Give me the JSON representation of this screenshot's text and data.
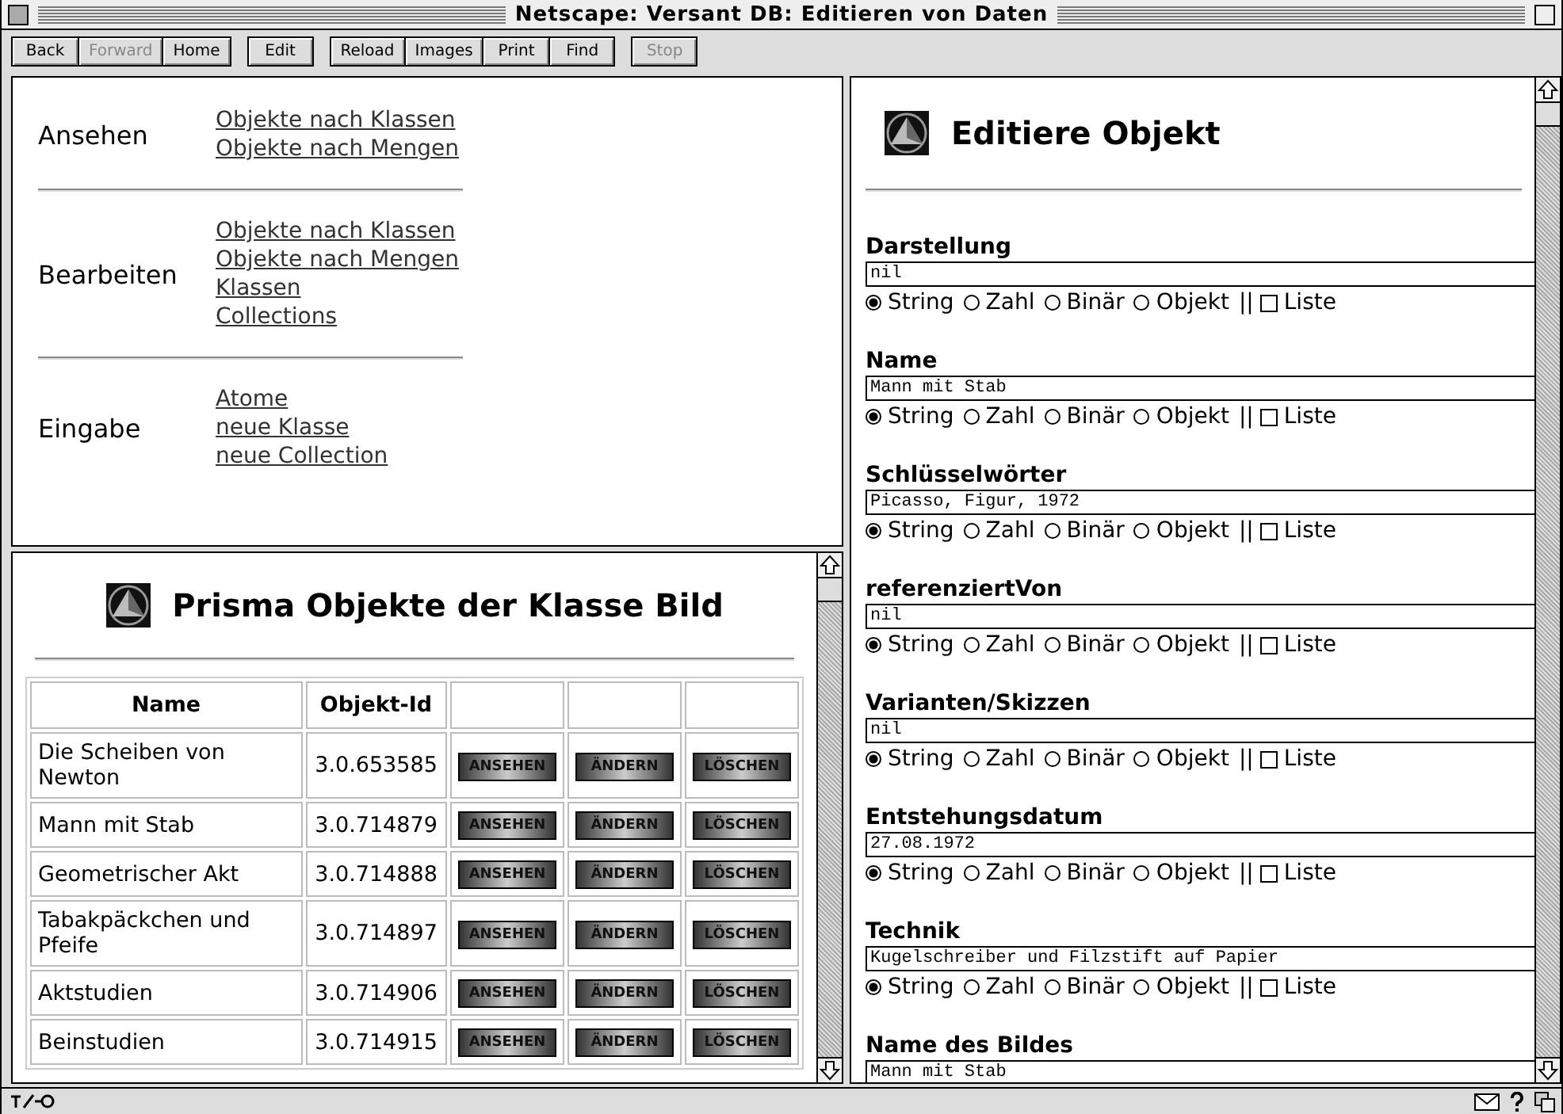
{
  "window": {
    "title": "Netscape: Versant DB: Editieren von Daten"
  },
  "toolbar": [
    {
      "group": [
        {
          "label": "Back",
          "disabled": false
        },
        {
          "label": "Forward",
          "disabled": true
        },
        {
          "label": "Home",
          "disabled": false
        }
      ]
    },
    {
      "group": [
        {
          "label": "Edit",
          "disabled": false
        }
      ]
    },
    {
      "group": [
        {
          "label": "Reload",
          "disabled": false
        },
        {
          "label": "Images",
          "disabled": false
        },
        {
          "label": "Print",
          "disabled": false
        },
        {
          "label": "Find",
          "disabled": false
        }
      ]
    },
    {
      "group": [
        {
          "label": "Stop",
          "disabled": true
        }
      ]
    }
  ],
  "nav": [
    {
      "title": "Ansehen",
      "links": [
        "Objekte nach Klassen",
        "Objekte nach Mengen"
      ]
    },
    {
      "title": "Bearbeiten",
      "links": [
        "Objekte nach Klassen",
        "Objekte nach Mengen",
        "Klassen",
        "Collections"
      ]
    },
    {
      "title": "Eingabe",
      "links": [
        "Atome",
        "neue Klasse",
        "neue Collection"
      ]
    }
  ],
  "list": {
    "heading": "Prisma Objekte der Klasse Bild",
    "columns": [
      "Name",
      "Objekt-Id"
    ],
    "rows": [
      {
        "name": "Die Scheiben von Newton",
        "id": "3.0.653585",
        "actions": [
          "ANSEHEN",
          "ÄNDERN",
          "LÖSCHEN"
        ]
      },
      {
        "name": "Mann mit Stab",
        "id": "3.0.714879",
        "actions": [
          "ANSEHEN",
          "ÄNDERN",
          "LÖSCHEN"
        ]
      },
      {
        "name": "Geometrischer Akt",
        "id": "3.0.714888",
        "actions": [
          "ANSEHEN",
          "ÄNDERN",
          "LÖSCHEN"
        ]
      },
      {
        "name": "Tabakpäckchen und Pfeife",
        "id": "3.0.714897",
        "actions": [
          "ANSEHEN",
          "ÄNDERN",
          "LÖSCHEN"
        ]
      },
      {
        "name": "Aktstudien",
        "id": "3.0.714906",
        "actions": [
          "ANSEHEN",
          "ÄNDERN",
          "LÖSCHEN"
        ]
      },
      {
        "name": "Beinstudien",
        "id": "3.0.714915",
        "actions": [
          "ANSEHEN",
          "ÄNDERN",
          "LÖSCHEN"
        ]
      }
    ]
  },
  "editor": {
    "heading": "Editiere Objekt",
    "fields": [
      {
        "label": "Darstellung",
        "value": "nil",
        "types": [
          {
            "label": "String",
            "selected": true
          },
          {
            "label": "Zahl",
            "selected": false
          },
          {
            "label": "Binär",
            "selected": false
          },
          {
            "label": "Objekt",
            "selected": false
          }
        ],
        "separator": "||",
        "list": {
          "label": "Liste",
          "checked": false
        }
      },
      {
        "label": "Name",
        "value": "Mann mit Stab",
        "types": [
          {
            "label": "String",
            "selected": true
          },
          {
            "label": "Zahl",
            "selected": false
          },
          {
            "label": "Binär",
            "selected": false
          },
          {
            "label": "Objekt",
            "selected": false
          }
        ],
        "separator": "||",
        "list": {
          "label": "Liste",
          "checked": false
        }
      },
      {
        "label": "Schlüsselwörter",
        "value": "Picasso, Figur, 1972",
        "types": [
          {
            "label": "String",
            "selected": true
          },
          {
            "label": "Zahl",
            "selected": false
          },
          {
            "label": "Binär",
            "selected": false
          },
          {
            "label": "Objekt",
            "selected": false
          }
        ],
        "separator": "||",
        "list": {
          "label": "Liste",
          "checked": false
        }
      },
      {
        "label": "referenziertVon",
        "value": "nil",
        "types": [
          {
            "label": "String",
            "selected": true
          },
          {
            "label": "Zahl",
            "selected": false
          },
          {
            "label": "Binär",
            "selected": false
          },
          {
            "label": "Objekt",
            "selected": false
          }
        ],
        "separator": "||",
        "list": {
          "label": "Liste",
          "checked": false
        }
      },
      {
        "label": "Varianten/Skizzen",
        "value": "nil",
        "types": [
          {
            "label": "String",
            "selected": true
          },
          {
            "label": "Zahl",
            "selected": false
          },
          {
            "label": "Binär",
            "selected": false
          },
          {
            "label": "Objekt",
            "selected": false
          }
        ],
        "separator": "||",
        "list": {
          "label": "Liste",
          "checked": false
        }
      },
      {
        "label": "Entstehungsdatum",
        "value": "27.08.1972",
        "types": [
          {
            "label": "String",
            "selected": true
          },
          {
            "label": "Zahl",
            "selected": false
          },
          {
            "label": "Binär",
            "selected": false
          },
          {
            "label": "Objekt",
            "selected": false
          }
        ],
        "separator": "||",
        "list": {
          "label": "Liste",
          "checked": false
        }
      },
      {
        "label": "Technik",
        "value": "Kugelschreiber und Filzstift auf Papier",
        "types": [
          {
            "label": "String",
            "selected": true
          },
          {
            "label": "Zahl",
            "selected": false
          },
          {
            "label": "Binär",
            "selected": false
          },
          {
            "label": "Objekt",
            "selected": false
          }
        ],
        "separator": "||",
        "list": {
          "label": "Liste",
          "checked": false
        }
      },
      {
        "label": "Name des Bildes",
        "value": "Mann mit Stab"
      }
    ]
  }
}
